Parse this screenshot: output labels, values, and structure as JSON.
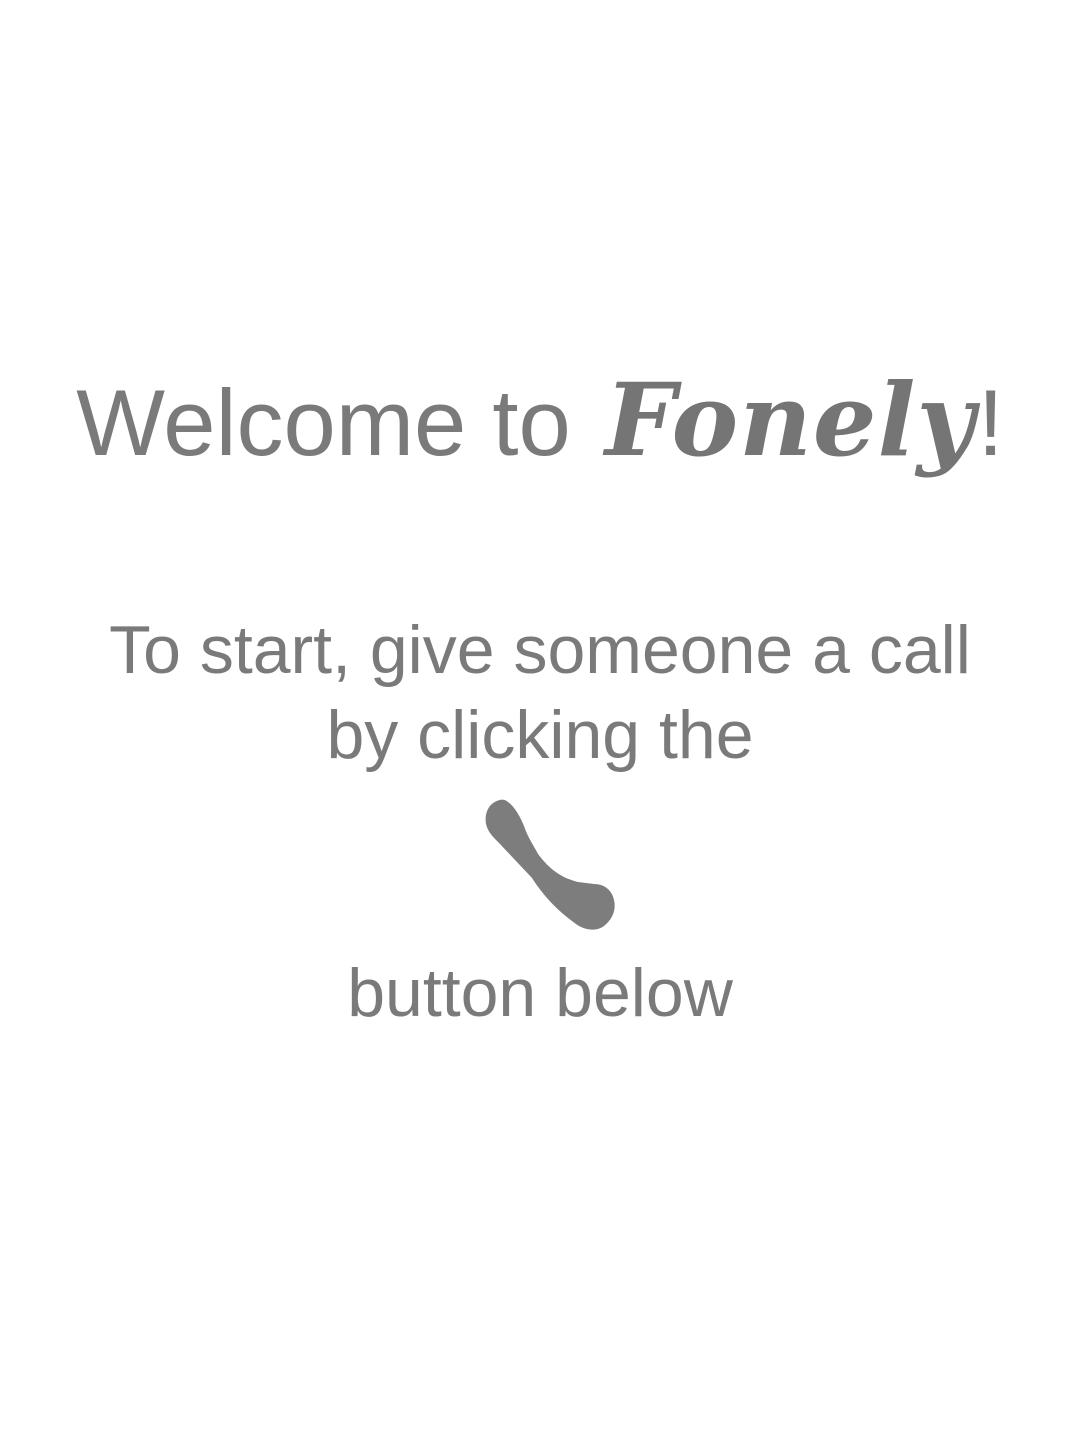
{
  "welcome": {
    "prefix": "Welcome to ",
    "brand": "Fonely",
    "suffix": "!"
  },
  "instructions": {
    "line1": "To start, give someone a call",
    "line2": "by clicking the",
    "icon": "phone-handset-icon",
    "line3": "button below"
  },
  "colors": {
    "text": "#7a7a7a",
    "icon": "#7d7d7d",
    "background": "#ffffff"
  }
}
